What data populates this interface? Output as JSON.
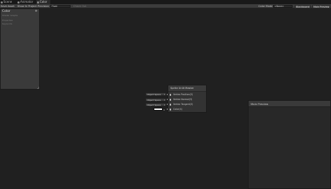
{
  "tabs": [
    {
      "label": "Scene",
      "icon": "scene-icon",
      "active": false
    },
    {
      "label": "Animator",
      "icon": "animator-icon",
      "active": false
    },
    {
      "label": "Color",
      "icon": "shader-graph-icon",
      "active": true
    }
  ],
  "toolbar": {
    "save_asset": "Save Asset",
    "show_in_project": "Show In Project",
    "precision_label": "Precision",
    "precision_value": "Float",
    "color_mode_label": "Color Mode",
    "color_mode_value": "<None>",
    "blackboard_button": "Blackboard",
    "main_preview_button": "Main Preview",
    "check_out": "Check Out"
  },
  "blackboard": {
    "title": "Color",
    "subtitle": "Shader Graphs",
    "add_icon": "plus-icon",
    "sections": [
      "Properties",
      "Keywords"
    ]
  },
  "node": {
    "title": "Sprite Unlit Master",
    "ports": [
      "Vertex Position(3)",
      "Vertex Normal(3)",
      "Vertex Tangent(3)",
      "Color(4)"
    ]
  },
  "inputs": [
    {
      "label": "Object Space"
    },
    {
      "label": "Object Space"
    },
    {
      "label": "Object Space"
    }
  ],
  "swatch_label": "A",
  "main_preview": {
    "title": "Main Preview"
  }
}
